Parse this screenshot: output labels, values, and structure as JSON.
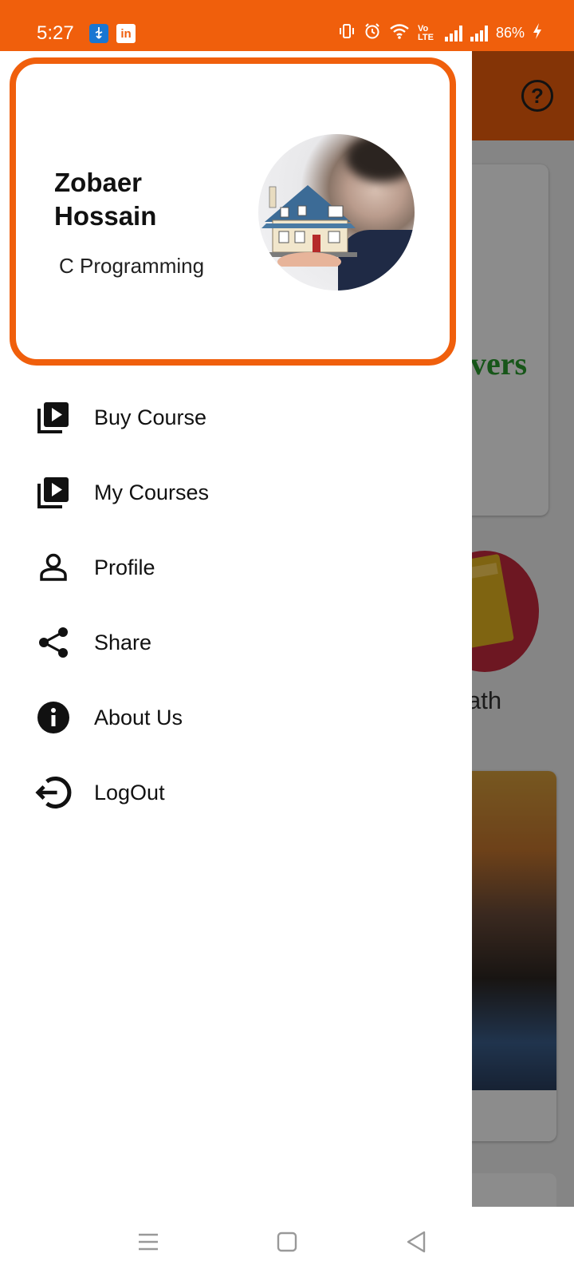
{
  "status_bar": {
    "time": "5:27",
    "battery": "86%",
    "network_label": "Vo LTE",
    "icons": [
      "usb-icon",
      "linkedin-icon",
      "vibrate-icon",
      "alarm-icon",
      "wifi-icon",
      "volte-icon",
      "signal-icon",
      "signal-icon",
      "battery-charging-icon"
    ]
  },
  "background": {
    "card_text": "vers",
    "circle_label": "ath"
  },
  "drawer": {
    "user_name": "Zobaer Hossain",
    "course": "C Programming",
    "accent_color": "#f05f0c",
    "items": [
      {
        "label": "Buy Course",
        "icon": "video-library-icon"
      },
      {
        "label": "My Courses",
        "icon": "video-library-icon"
      },
      {
        "label": "Profile",
        "icon": "person-icon"
      },
      {
        "label": "Share",
        "icon": "share-icon"
      },
      {
        "label": "About Us",
        "icon": "info-icon"
      },
      {
        "label": "LogOut",
        "icon": "logout-icon"
      }
    ]
  },
  "nav_bar": {
    "icons": [
      "menu-icon",
      "home-icon",
      "back-icon"
    ]
  }
}
